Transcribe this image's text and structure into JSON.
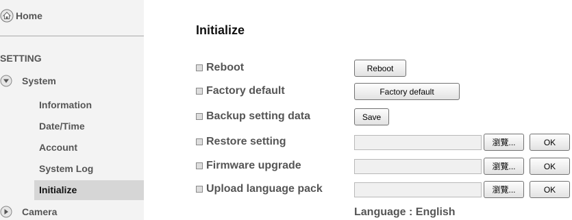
{
  "sidebar": {
    "home_label": "Home",
    "section_title": "SETTING",
    "system_label": "System",
    "items": [
      {
        "label": "Information"
      },
      {
        "label": "Date/Time"
      },
      {
        "label": "Account"
      },
      {
        "label": "System Log"
      },
      {
        "label": "Initialize"
      }
    ],
    "camera_label": "Camera"
  },
  "main": {
    "title": "Initialize",
    "rows": [
      {
        "label": "Reboot",
        "button": "Reboot"
      },
      {
        "label": "Factory default",
        "button": "Factory default"
      },
      {
        "label": "Backup setting data",
        "button": "Save"
      },
      {
        "label": "Restore setting",
        "file_value": "",
        "browse": "瀏覽...",
        "ok": "OK"
      },
      {
        "label": "Firmware upgrade",
        "file_value": "",
        "browse": "瀏覽...",
        "ok": "OK"
      },
      {
        "label": "Upload language pack",
        "file_value": "",
        "browse": "瀏覽...",
        "ok": "OK"
      }
    ],
    "language": "Language : English"
  },
  "colors": {
    "sidebar_bg": "#f3f3f3",
    "active_bg": "#d6d6d6",
    "label_text": "#555555"
  }
}
